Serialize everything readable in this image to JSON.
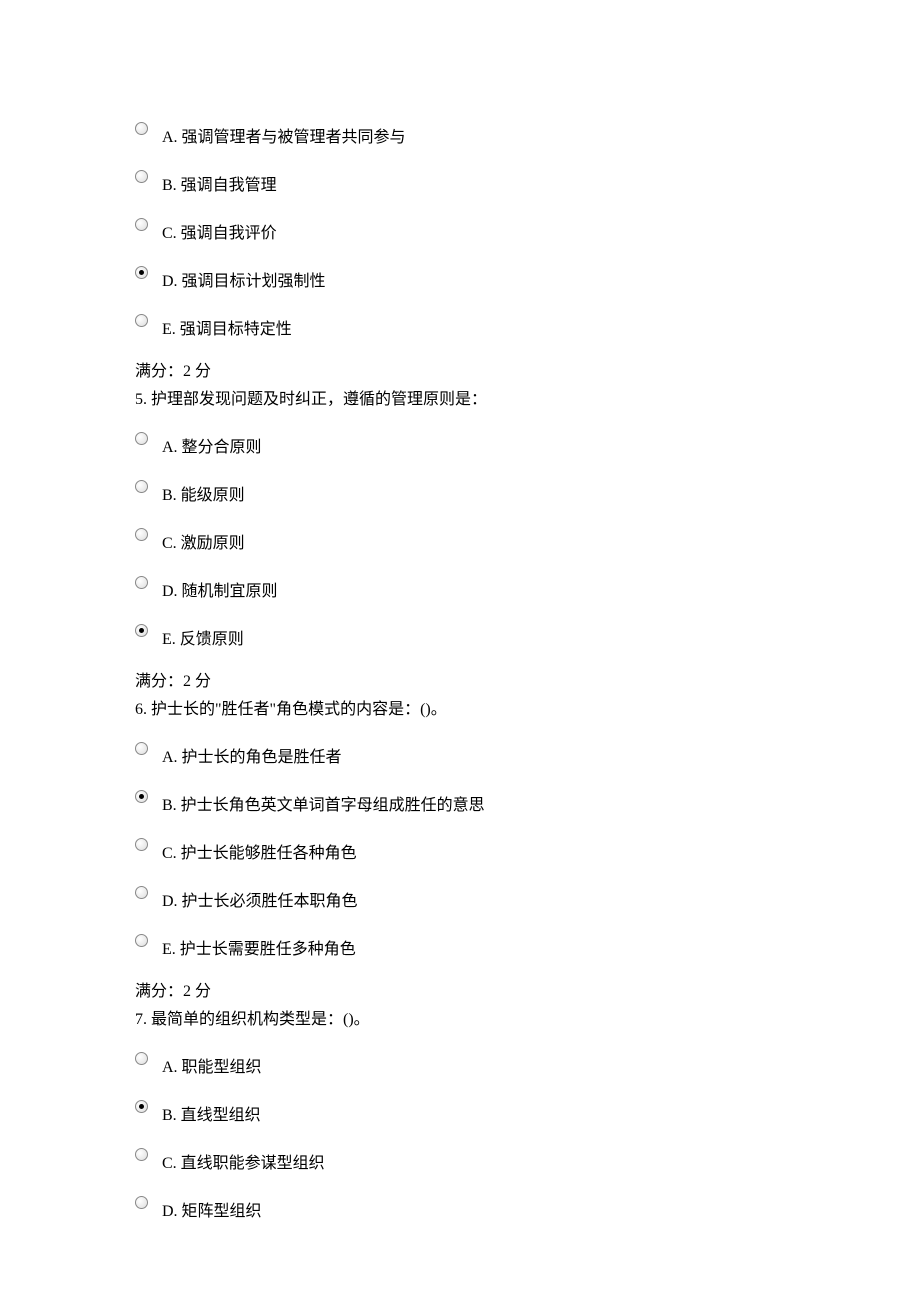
{
  "questions": [
    {
      "number": "",
      "text": "",
      "options": [
        {
          "label": "A.  强调管理者与被管理者共同参与",
          "selected": false
        },
        {
          "label": "B.  强调自我管理",
          "selected": false
        },
        {
          "label": "C.  强调自我评价",
          "selected": false
        },
        {
          "label": "D.  强调目标计划强制性",
          "selected": true
        },
        {
          "label": "E.  强调目标特定性",
          "selected": false
        }
      ],
      "score": "满分：2 分"
    },
    {
      "number": "5.",
      "text": " 护理部发现问题及时纠正，遵循的管理原则是：",
      "options": [
        {
          "label": "A.  整分合原则",
          "selected": false
        },
        {
          "label": "B.  能级原则",
          "selected": false
        },
        {
          "label": "C.  激励原则",
          "selected": false
        },
        {
          "label": "D.  随机制宜原则",
          "selected": false
        },
        {
          "label": "E.  反馈原则",
          "selected": true
        }
      ],
      "score": "满分：2 分"
    },
    {
      "number": "6.",
      "text": " 护士长的\"胜任者\"角色模式的内容是：()。",
      "options": [
        {
          "label": "A.  护士长的角色是胜任者",
          "selected": false
        },
        {
          "label": "B.  护士长角色英文单词首字母组成胜任的意思",
          "selected": true
        },
        {
          "label": "C.  护士长能够胜任各种角色",
          "selected": false
        },
        {
          "label": "D.  护士长必须胜任本职角色",
          "selected": false
        },
        {
          "label": "E.  护士长需要胜任多种角色",
          "selected": false
        }
      ],
      "score": "满分：2 分"
    },
    {
      "number": "7.",
      "text": " 最简单的组织机构类型是：()。",
      "options": [
        {
          "label": "A.  职能型组织",
          "selected": false
        },
        {
          "label": "B.  直线型组织",
          "selected": true
        },
        {
          "label": "C.  直线职能参谋型组织",
          "selected": false
        },
        {
          "label": "D.  矩阵型组织",
          "selected": false
        }
      ],
      "score": ""
    }
  ]
}
